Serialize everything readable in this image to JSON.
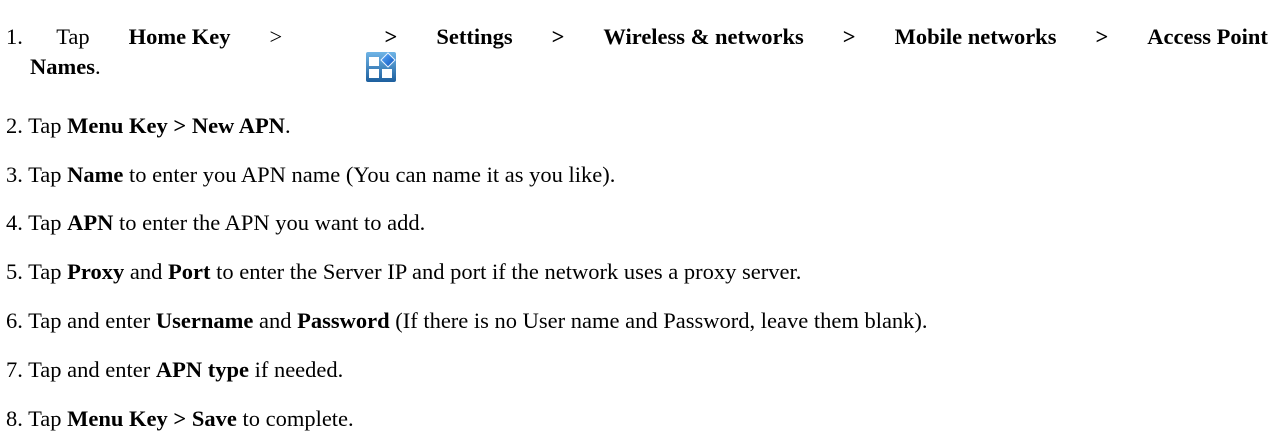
{
  "steps": [
    {
      "num": "1.",
      "parts": [
        "Tap ",
        "Home Key",
        " > ",
        "> ",
        "Settings",
        " > ",
        "Wireless & networks",
        " > ",
        "Mobile networks",
        " > ",
        "Access Point",
        "Names",
        "."
      ],
      "icon": "apps-grid-icon"
    },
    {
      "num": "2.",
      "parts": [
        "Tap ",
        "Menu Key > New APN",
        "."
      ]
    },
    {
      "num": "3.",
      "parts": [
        "Tap ",
        "Name",
        " to enter you APN name (You can name it as you like)."
      ]
    },
    {
      "num": "4.",
      "parts": [
        "Tap ",
        "APN",
        " to enter the APN you want to add."
      ]
    },
    {
      "num": "5.",
      "parts": [
        "Tap ",
        "Proxy",
        " and ",
        "Port",
        " to enter the Server IP and port if the network uses a proxy server."
      ]
    },
    {
      "num": "6.",
      "parts": [
        "Tap and enter ",
        "Username",
        " and ",
        "Password",
        " (If there is no User name and Password, leave them blank)."
      ]
    },
    {
      "num": "7.",
      "parts": [
        "Tap and enter ",
        "APN type",
        " if needed."
      ]
    },
    {
      "num": "8.",
      "parts": [
        "Tap ",
        "Menu Key > Save",
        " to complete."
      ]
    }
  ],
  "colors": {
    "text": "#000000",
    "icon_tile": "#ffffff",
    "icon_bg_top": "#5aa2d8",
    "icon_bg_bottom": "#1d5f9e",
    "icon_diamond": "#1f6fd0"
  }
}
